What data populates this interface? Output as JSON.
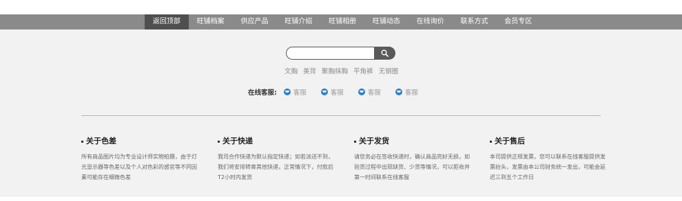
{
  "nav": {
    "items": [
      {
        "label": "返回顶部",
        "active": true
      },
      {
        "label": "旺铺档案"
      },
      {
        "label": "供应产品"
      },
      {
        "label": "旺铺介绍"
      },
      {
        "label": "旺铺相册"
      },
      {
        "label": "旺铺动态"
      },
      {
        "label": "在线询价"
      },
      {
        "label": "联系方式"
      },
      {
        "label": "会员专区"
      }
    ]
  },
  "search": {
    "placeholder": "",
    "button_icon": "search-icon",
    "hot_words": [
      "文胸",
      "美背",
      "聚胸抹胸",
      "平角裤",
      "无钢圈"
    ]
  },
  "customer_service": {
    "label": "在线客服:",
    "items": [
      "客服",
      "客服",
      "客服",
      "客服"
    ],
    "icon_color": "#2f80c9"
  },
  "info": [
    {
      "title": "关于色差",
      "text": "所有商品图片均为专业设计师实物拍摄，由于灯光显示器等色差以及个人对色彩的感官等不同因素可能存在细微色差"
    },
    {
      "title": "关于快递",
      "text": "我司合作快递为默认指定快递；如若派送不到，我们将安排转寄其他快递，正常情况下，付款后T2小时内发货"
    },
    {
      "title": "关于发货",
      "text": "请您务必在签收快递时，确认商品完好无损，如验货过程中出现缺货、少货等情况，可以拒收并第一时间联系在线客服"
    },
    {
      "title": "关于售后",
      "text": "本司提供正规发票，您可以联系在线客服提供发票抬头，发票由本公司财务统一发出，可能会延迟三到五个工作日"
    }
  ],
  "colors": {
    "nav_bg": "#8a8a8a",
    "nav_active_bg": "#4f4f4f",
    "page_bg": "#f2f2f2"
  }
}
